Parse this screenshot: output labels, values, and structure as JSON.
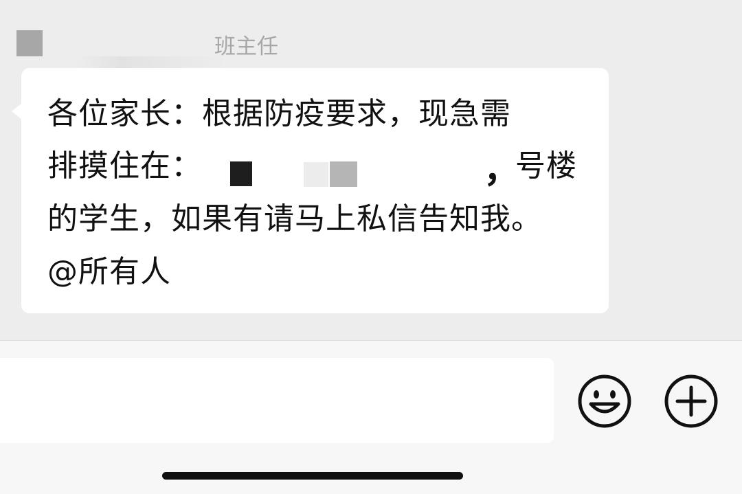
{
  "chat": {
    "sender_name": "班主任",
    "message": {
      "line1": "各位家长：根据防疫要求，现急需",
      "line2_start": "排摸住在：",
      "line2_comma": "，",
      "line2_end": "号楼",
      "line3": "的学生，如果有请马上私信告知我。",
      "line4": "@所有人"
    }
  },
  "input_bar": {
    "input_value": "",
    "emoji_icon": "smiley-face-icon",
    "more_icon": "plus-circle-icon"
  }
}
